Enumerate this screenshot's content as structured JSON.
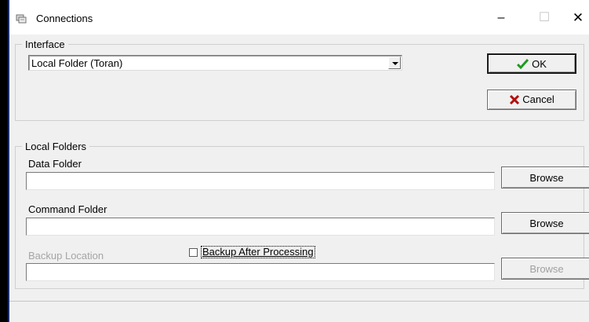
{
  "window": {
    "title": "Connections",
    "icon": "connections-app-icon",
    "controls": {
      "minimize": "–",
      "maximize": "☐",
      "close": "✕"
    }
  },
  "interface": {
    "group_label": "Interface",
    "selected": "Local Folder (Toran)"
  },
  "buttons": {
    "ok_label": "OK",
    "ok_icon": "checkmark-icon",
    "cancel_label": "Cancel",
    "cancel_icon": "cross-icon"
  },
  "local_folders": {
    "group_label": "Local Folders",
    "data_folder": {
      "label": "Data Folder",
      "value": "",
      "browse_label": "Browse"
    },
    "command_folder": {
      "label": "Command Folder",
      "value": "",
      "browse_label": "Browse"
    },
    "backup_location": {
      "label": "Backup Location",
      "value": "",
      "browse_label": "Browse",
      "enabled": false
    },
    "backup_after_processing": {
      "label": "Backup After Processing",
      "checked": false
    }
  },
  "colors": {
    "ok_check": "#1e9a1e",
    "cancel_cross": "#b01010",
    "disabled_text": "#a5a5a5"
  }
}
